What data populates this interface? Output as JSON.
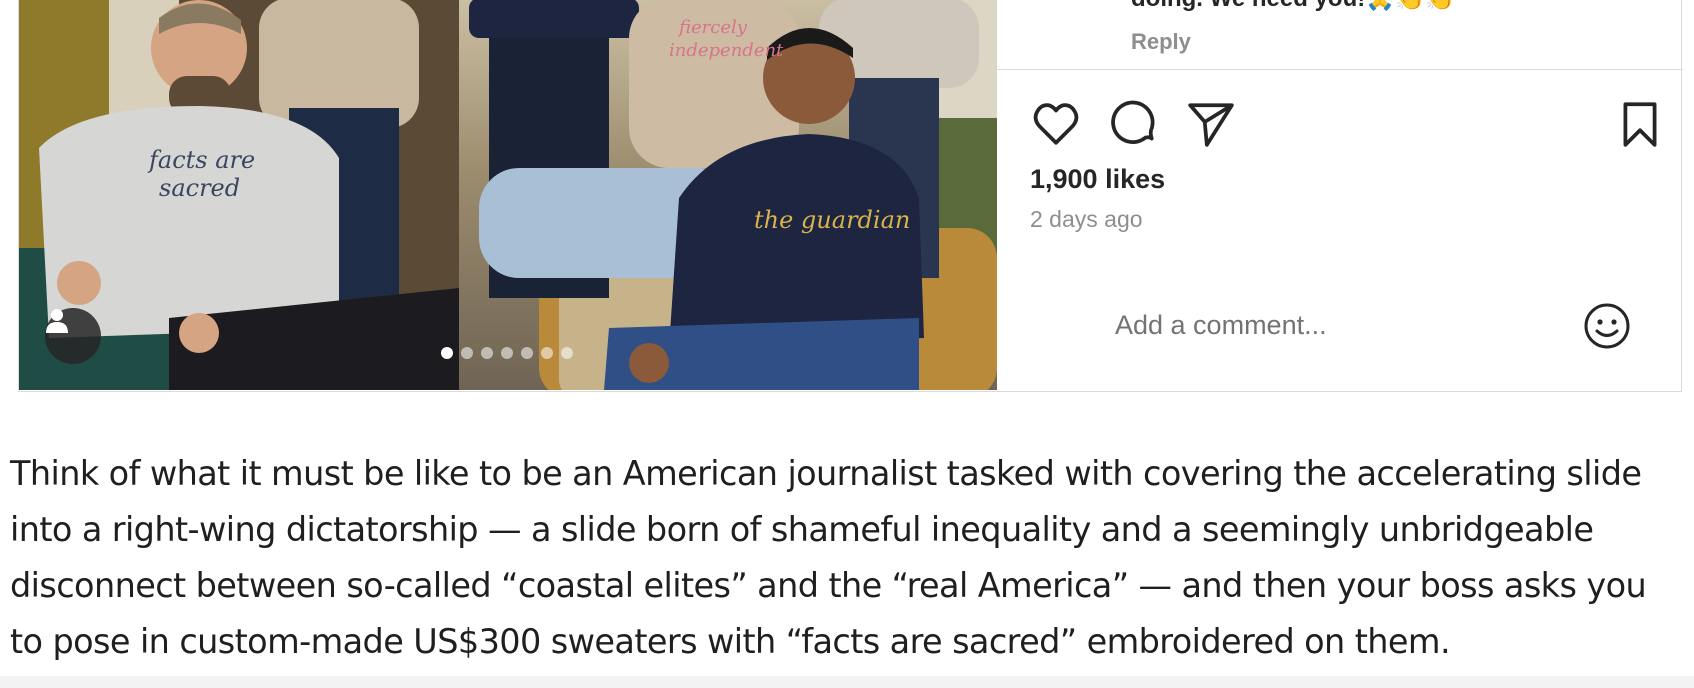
{
  "post": {
    "comment_tail": "doing. We need you!🙏👏👏",
    "reply_label": "Reply",
    "likes": "1,900 likes",
    "time_ago": "2 days ago",
    "comment_placeholder": "Add a comment...",
    "carousel": {
      "slide_count": 7,
      "active_index": 0
    },
    "sweater_texts": [
      "facts are sacred",
      "fiercely independent",
      "the guardian"
    ]
  },
  "icons": {
    "like": "heart-icon",
    "comment": "speech-bubble-icon",
    "share": "paper-plane-icon",
    "save": "bookmark-icon",
    "emoji": "smiley-icon",
    "user_tag": "person-icon"
  },
  "article": {
    "paragraph": "Think of what it must be like to be an American journalist tasked with covering the accelerating slide into a right-wing dictatorship — a slide born of shameful inequality and a seemingly unbridgeable disconnect between so-called “coastal elites” and the “real America” — and then your boss asks you to pose in custom-made US$300 sweaters with “facts are sacred” embroidered on them."
  },
  "colors": {
    "text_primary": "#262626",
    "text_secondary": "#8e8e8e",
    "border": "#dbdbdb",
    "embroidery_gold": "#d8b24a",
    "embroidery_navy": "#3a4560",
    "embroidery_pink": "#d9738a"
  }
}
